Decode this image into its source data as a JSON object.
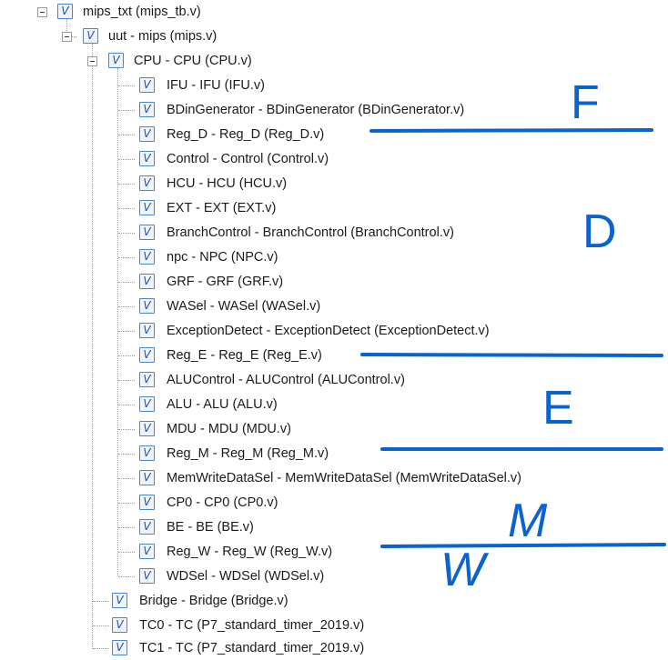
{
  "tree": {
    "root": {
      "label": "mips_txt (mips_tb.v)"
    },
    "uut": {
      "label": "uut - mips (mips.v)"
    },
    "cpu": {
      "label": "CPU - CPU (CPU.v)"
    },
    "cpu_children": [
      "IFU - IFU (IFU.v)",
      "BDinGenerator - BDinGenerator (BDinGenerator.v)",
      "Reg_D - Reg_D (Reg_D.v)",
      "Control - Control (Control.v)",
      "HCU - HCU (HCU.v)",
      "EXT - EXT (EXT.v)",
      "BranchControl - BranchControl (BranchControl.v)",
      "npc - NPC (NPC.v)",
      "GRF - GRF (GRF.v)",
      "WASel - WASel (WASel.v)",
      "ExceptionDetect - ExceptionDetect (ExceptionDetect.v)",
      "Reg_E - Reg_E (Reg_E.v)",
      "ALUControl - ALUControl (ALUControl.v)",
      "ALU - ALU (ALU.v)",
      "MDU - MDU (MDU.v)",
      "Reg_M - Reg_M (Reg_M.v)",
      "MemWriteDataSel - MemWriteDataSel (MemWriteDataSel.v)",
      "CP0 - CP0 (CP0.v)",
      "BE - BE (BE.v)",
      "Reg_W - Reg_W (Reg_W.v)",
      "WDSel - WDSel (WDSel.v)"
    ],
    "uut_children": [
      "Bridge - Bridge (Bridge.v)",
      "TC0 - TC (P7_standard_timer_2019.v)",
      "TC1 - TC (P7_standard_timer_2019.v)"
    ]
  },
  "annotations": {
    "letters": [
      "F",
      "D",
      "E",
      "M",
      "W"
    ],
    "color": "#0a63d1"
  },
  "colors": {
    "tree_line": "#a0a0a0",
    "icon_border": "#4d86c6"
  },
  "icons": {
    "expander": "minus-box-icon",
    "module": "verilog-file-icon"
  }
}
